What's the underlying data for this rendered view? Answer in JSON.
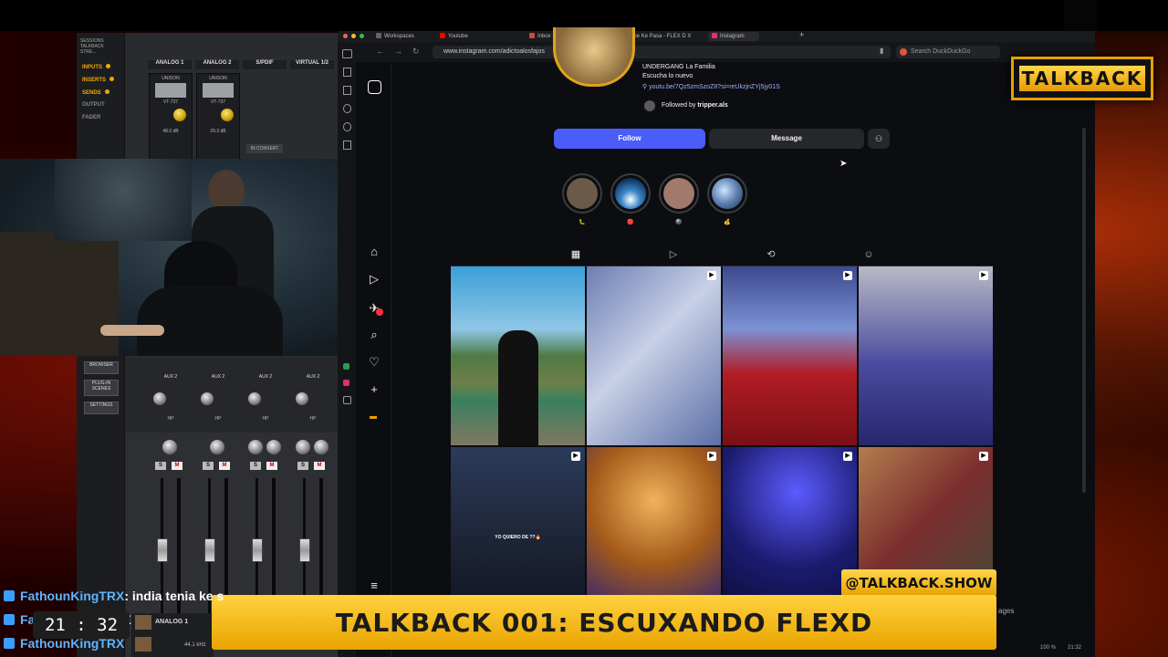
{
  "browser": {
    "tabs": [
      {
        "label": "Workspaces",
        "color": "#666666"
      },
      {
        "label": "Youtube",
        "color": "#ff0000"
      },
      {
        "label": "Inbox - contacto.talkback.",
        "color": "#d44638"
      },
      {
        "label": "Dime Ke Pasa - FLEX D X",
        "color": "#ff3b30"
      },
      {
        "label": "Instagram",
        "color": "#e1306c"
      }
    ],
    "url": "www.instagram.com/adictoalosfajos",
    "search_placeholder": "Search DuckDuckGo",
    "status_zoom": "100 %",
    "status_time": "21:32",
    "footer_partial": "ages"
  },
  "profile": {
    "bio_line1": "UNDERGANG La Familia",
    "bio_line2": "Escucha lo nuevo",
    "bio_link": "youtu.be/7Qz5zmSzoZ8?si=reUkzjnZYj5jy01S",
    "followed_by_prefix": "Followed by",
    "followed_by_user": "tripper.als",
    "follow_label": "Follow",
    "message_label": "Message",
    "highlights": [
      {
        "label": "🐛",
        "color": "#6b5a4a"
      },
      {
        "label": "🔴",
        "color": "#3a86c8"
      },
      {
        "label": "🎱",
        "color": "#a07a6a"
      },
      {
        "label": "💰",
        "color": "#5d7fb0"
      }
    ],
    "posts": [
      {
        "reel": false,
        "text": ""
      },
      {
        "reel": true,
        "text": ""
      },
      {
        "reel": true,
        "text": ""
      },
      {
        "reel": true,
        "text": ""
      },
      {
        "reel": true,
        "text": "YO QUIERO DE ??🔥"
      },
      {
        "reel": true,
        "text": ""
      },
      {
        "reel": true,
        "text": ""
      },
      {
        "reel": true,
        "text": ""
      }
    ]
  },
  "mixer": {
    "title": "SESSIONS TALKBACK STRE...",
    "menu": [
      "INPUTS",
      "INSERTS",
      "SENDS",
      "OUTPUT",
      "FADER"
    ],
    "side_buttons": [
      "BROWSER",
      "PLUG-IN SCENES",
      "SETTINGS"
    ],
    "channels": [
      "ANALOG 1",
      "ANALOG 2",
      "S/PDIF",
      "VIRTUAL 1/2"
    ],
    "preamp": "VT-737",
    "gain_values": [
      "48.0 dB",
      "29.3 dB"
    ],
    "aux_label": "AUX 2",
    "hp_label": "HP",
    "footer_channel": "ANALOG 1",
    "footer_rate": "44.1 kHz",
    "tags": {
      "unison": "UNISON",
      "mic": "MIC",
      "in": "IN",
      "v48": "48V",
      "pad": "PAD",
      "convert": "IN CONVERT",
      "open": "OPEN",
      "close": "CLOSE",
      "lock": "LOCK",
      "small": "SMALL"
    }
  },
  "overlay": {
    "logo_text": "TALKBACK",
    "handle": "@TALKBACK.SHOW",
    "banner": "TALKBACK 001: ESCUXANDO FLEXD",
    "clock": "21 : 32"
  },
  "chat": [
    {
      "name": "FathounKingTRX",
      "message": ": india tenia ke s"
    },
    {
      "name": "Fa",
      "message": "X"
    },
    {
      "name": "FathounKingTRX",
      "message": ""
    }
  ],
  "colors": {
    "accent": "#f2a900",
    "follow": "#4a5df9",
    "link": "#9fb4ff"
  }
}
